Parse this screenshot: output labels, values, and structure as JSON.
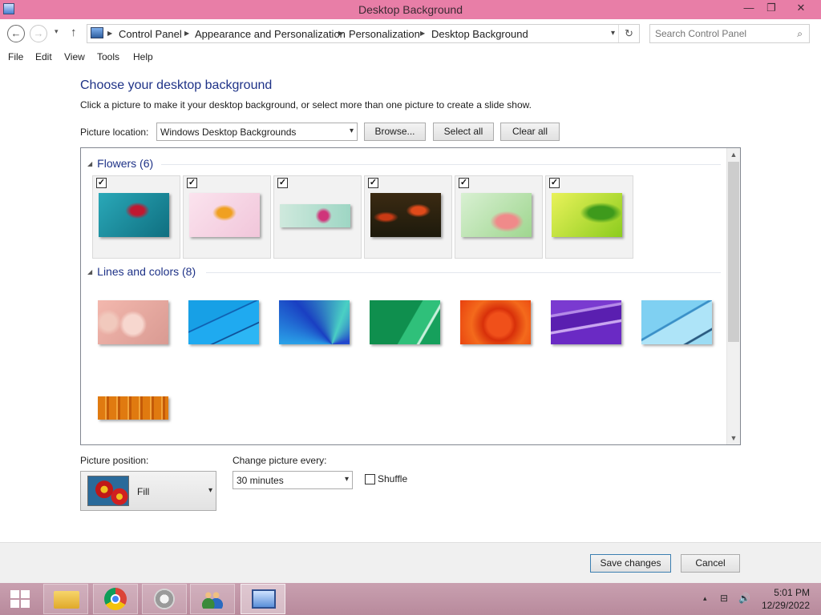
{
  "window": {
    "title": "Desktop Background",
    "minimize": "—",
    "restore": "❐",
    "close": "✕"
  },
  "addressbar": {
    "back": "←",
    "forward": "→",
    "recent": "▾",
    "up": "↑",
    "crumbs": [
      "Control Panel",
      "Appearance and Personalization",
      "Personalization",
      "Desktop Background"
    ],
    "separator": "▶",
    "dropdown": "▾",
    "refresh": "↻",
    "search_placeholder": "Search Control Panel",
    "search_icon": "⌕"
  },
  "menu": [
    "File",
    "Edit",
    "View",
    "Tools",
    "Help"
  ],
  "content": {
    "heading": "Choose your desktop background",
    "description": "Click a picture to make it your desktop background, or select more than one picture to create a slide show.",
    "location_label": "Picture location:",
    "location_value": "Windows Desktop Backgrounds",
    "browse": "Browse...",
    "select_all": "Select all",
    "clear_all": "Clear all"
  },
  "groups": [
    {
      "name": "Flowers (6)",
      "items": [
        {
          "checked": true,
          "thumb": "flower-red-on-teal"
        },
        {
          "checked": true,
          "thumb": "flower-orange-on-pink"
        },
        {
          "checked": true,
          "thumb": "flower-pink-on-mint"
        },
        {
          "checked": true,
          "thumb": "tulips-on-dark"
        },
        {
          "checked": true,
          "thumb": "flower-pink-on-green"
        },
        {
          "checked": true,
          "thumb": "leaves-lime"
        }
      ]
    },
    {
      "name": "Lines and colors (8)",
      "items": [
        {
          "checked": false,
          "thumb": "cartoon-pink"
        },
        {
          "checked": false,
          "thumb": "blue-lines"
        },
        {
          "checked": false,
          "thumb": "blue-fan"
        },
        {
          "checked": false,
          "thumb": "green-curve"
        },
        {
          "checked": false,
          "thumb": "orange-red-swirl"
        },
        {
          "checked": false,
          "thumb": "purple-waves"
        },
        {
          "checked": false,
          "thumb": "light-blue-curve"
        },
        {
          "checked": false,
          "thumb": "orange-stripes"
        }
      ]
    }
  ],
  "checkmark": "✓",
  "collapse_glyph": "◢",
  "scrollbar": {
    "up": "▲",
    "down": "▼"
  },
  "position": {
    "label": "Picture position:",
    "value": "Fill",
    "arrow": "▾"
  },
  "interval": {
    "label": "Change picture every:",
    "value": "30 minutes",
    "arrow": "▾"
  },
  "shuffle": {
    "label": "Shuffle",
    "checked": false
  },
  "footer": {
    "save": "Save changes",
    "cancel": "Cancel"
  },
  "taskbar": {
    "apps": [
      "file-explorer",
      "chrome",
      "speaker",
      "network-people",
      "control-panel"
    ],
    "tray": {
      "chevron": "▴",
      "network": "⊟",
      "volume": "🔊"
    },
    "time": "5:01 PM",
    "date": "12/29/2022"
  },
  "colors": {
    "titlebar": "#e87ea7",
    "heading": "#1e3287",
    "taskbar": "#c39aab"
  }
}
